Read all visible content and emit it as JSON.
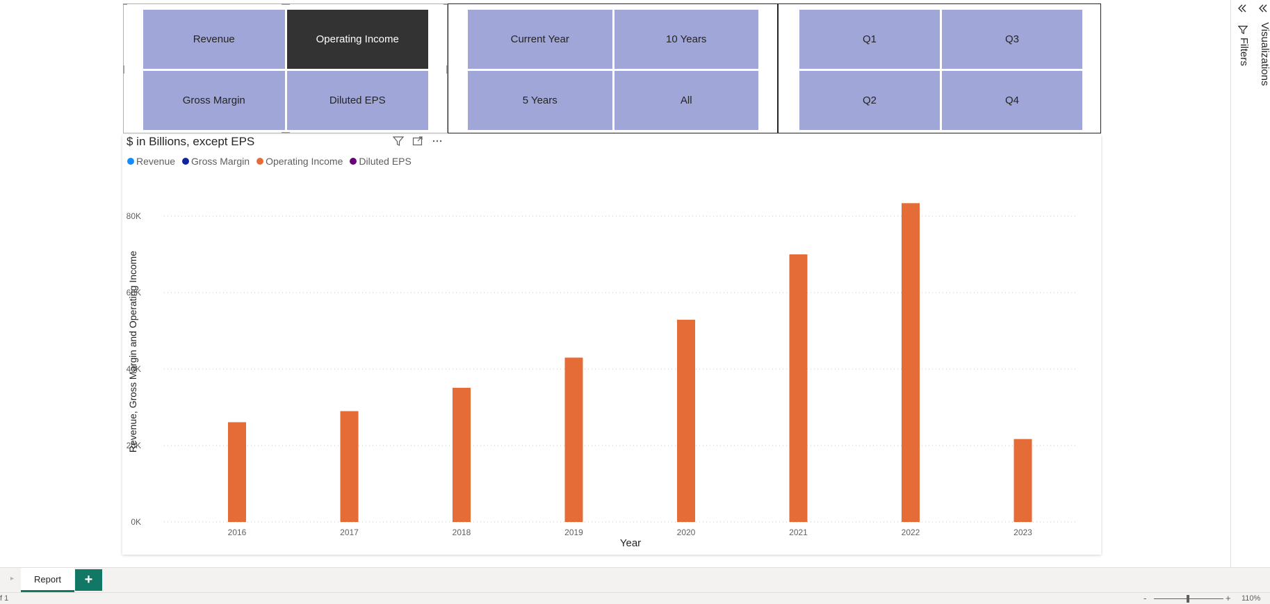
{
  "slicers": {
    "metric": {
      "items": [
        "Revenue",
        "Operating Income",
        "Gross Margin",
        "Diluted EPS"
      ],
      "selected": "Operating Income"
    },
    "period": {
      "items": [
        "Current Year",
        "10 Years",
        "5 Years",
        "All"
      ]
    },
    "quarter": {
      "items": [
        "Q1",
        "Q3",
        "Q2",
        "Q4"
      ]
    }
  },
  "visual": {
    "title": "$ in Billions, except EPS",
    "icons": [
      "filter-icon",
      "focus-mode-icon",
      "more-options-icon"
    ],
    "legend": [
      {
        "label": "Revenue",
        "color": "#118dff"
      },
      {
        "label": "Gross Margin",
        "color": "#12239e"
      },
      {
        "label": "Operating Income",
        "color": "#e66c37"
      },
      {
        "label": "Diluted EPS",
        "color": "#6b007b"
      }
    ]
  },
  "chart_data": {
    "type": "bar",
    "categories": [
      "2016",
      "2017",
      "2018",
      "2019",
      "2020",
      "2021",
      "2022",
      "2023"
    ],
    "series": [
      {
        "name": "Operating Income",
        "color": "#e66c37",
        "values": [
          26100,
          29000,
          35100,
          43000,
          52900,
          70000,
          83400,
          21700
        ]
      }
    ],
    "xlabel": "Year",
    "ylabel": "Revenue, Gross Margin and Operating Income",
    "yticks": [
      "0K",
      "20K",
      "40K",
      "60K",
      "80K"
    ],
    "ylim": [
      0,
      80000
    ],
    "grid": true
  },
  "panes": {
    "collapse_icon": "double-chevron-left-icon",
    "filters_label": "Filters",
    "visualizations_label": "Visualizations"
  },
  "tabs": {
    "page_label": "Report",
    "add_label": "+"
  },
  "status": {
    "page_info": "f 1",
    "zoom_minus": "-",
    "zoom_plus": "+",
    "zoom_level": "110%"
  }
}
